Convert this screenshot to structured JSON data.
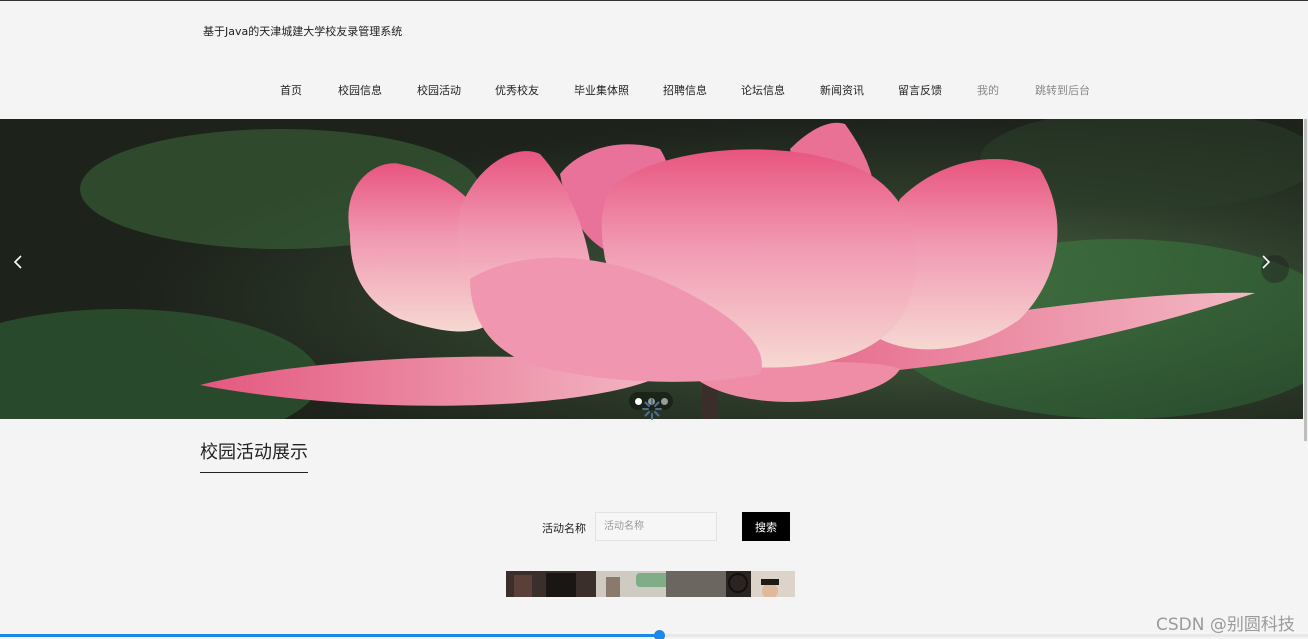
{
  "site": {
    "title": "基于Java的天津城建大学校友录管理系统"
  },
  "nav": {
    "items": [
      {
        "label": "首页"
      },
      {
        "label": "校园信息"
      },
      {
        "label": "校园活动"
      },
      {
        "label": "优秀校友"
      },
      {
        "label": "毕业集体照"
      },
      {
        "label": "招聘信息"
      },
      {
        "label": "论坛信息"
      },
      {
        "label": "新闻资讯"
      },
      {
        "label": "留言反馈"
      },
      {
        "label": "我的"
      },
      {
        "label": "跳转到后台"
      }
    ]
  },
  "banner": {
    "slide_count": 3,
    "active_slide": 1
  },
  "section": {
    "title": "校园活动展示"
  },
  "search": {
    "label": "活动名称",
    "placeholder": "活动名称",
    "value": "",
    "button_label": "搜索"
  },
  "video_progress": {
    "fraction": 0.504
  },
  "watermark": {
    "text": "CSDN @别圆科技"
  },
  "colors": {
    "accent": "#1e88e5",
    "button": "#000000",
    "lotus": "#ec8aa4"
  }
}
